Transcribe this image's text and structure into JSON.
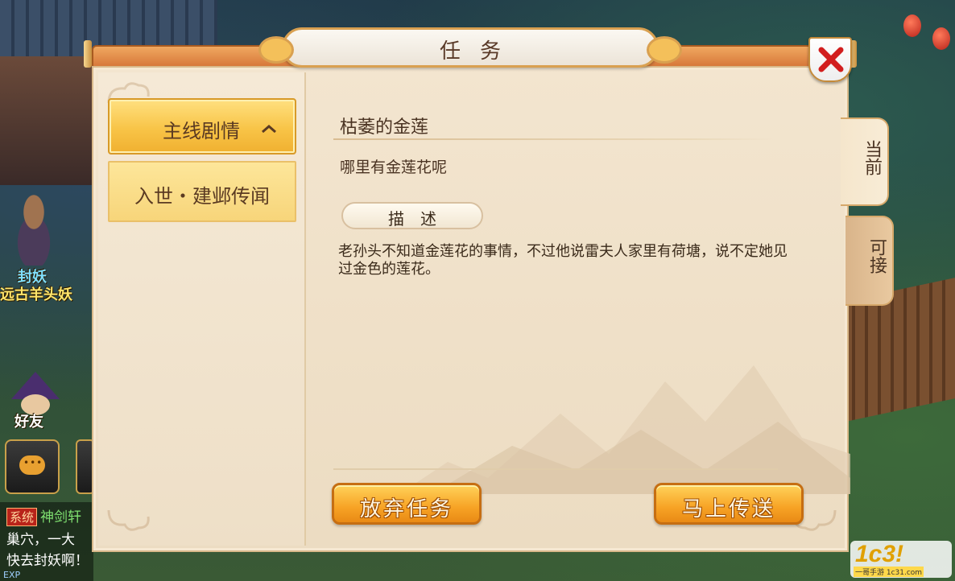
{
  "dialog": {
    "title": "任务",
    "close_icon": "close-x-icon"
  },
  "sidebar": {
    "category_label": "主线剧情",
    "category_icon": "chevron-up-icon",
    "quest_item_label": "入世・建邺传闻"
  },
  "content": {
    "quest_title": "枯萎的金莲",
    "quest_subtitle": "哪里有金莲花呢",
    "description_header": "描述",
    "description_body": "老孙头不知道金莲花的事情，不过他说雷夫人家里有荷塘，说不定她见过金色的莲花。"
  },
  "buttons": {
    "abandon": "放弃任务",
    "teleport": "马上传送"
  },
  "side_tabs": {
    "current": "当前",
    "available": "可接"
  },
  "background_hud": {
    "seal_label": "封妖",
    "monster_label": "远古羊头妖",
    "friends_label": "好友",
    "chat_tag": "系统",
    "chat_line1": "神剑轩",
    "chat_line2": "巢穴，一大",
    "chat_line3": "快去封妖啊！",
    "exp_label": "EXP",
    "logo_text": "1c3!",
    "logo_sub": "一哥手游 1c31.com"
  },
  "colors": {
    "panel_bg": "#f3e5cf",
    "accent_orange": "#f7a325",
    "button_gold": "#f8c447",
    "text_brown": "#4a3322",
    "close_red": "#d21e1e"
  }
}
